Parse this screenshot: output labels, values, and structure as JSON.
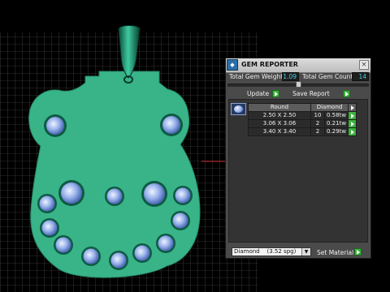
{
  "panel": {
    "title": "GEM REPORTER",
    "close_glyph": "×",
    "app_icon": "gem-reporter-icon",
    "total_weight_label": "Total Gem Weight",
    "total_weight_value": "1.09",
    "total_count_label": "Total Gem Count",
    "total_count_value": "14",
    "update_label": "Update",
    "save_report_label": "Save Report",
    "table": {
      "headers": [
        "Round",
        "Diamond"
      ],
      "rows": [
        {
          "size": "2.50 X 2.50",
          "count": "10",
          "weight": "0.58tw"
        },
        {
          "size": "3.06 X 3.06",
          "count": "2",
          "weight": "0.21tw"
        },
        {
          "size": "3.40 X 3.40",
          "count": "2",
          "weight": "0.29tw"
        }
      ]
    },
    "material_select": "Diamond    (3.52 spg)",
    "set_material_label": "Set Material"
  },
  "colors": {
    "pendant": "#38b488",
    "bail": "#0f7a5a",
    "gem": "#8aa6e8",
    "grid": "#666666",
    "accent_value": "#3fd3e6",
    "button_green": "#3bb13b"
  }
}
